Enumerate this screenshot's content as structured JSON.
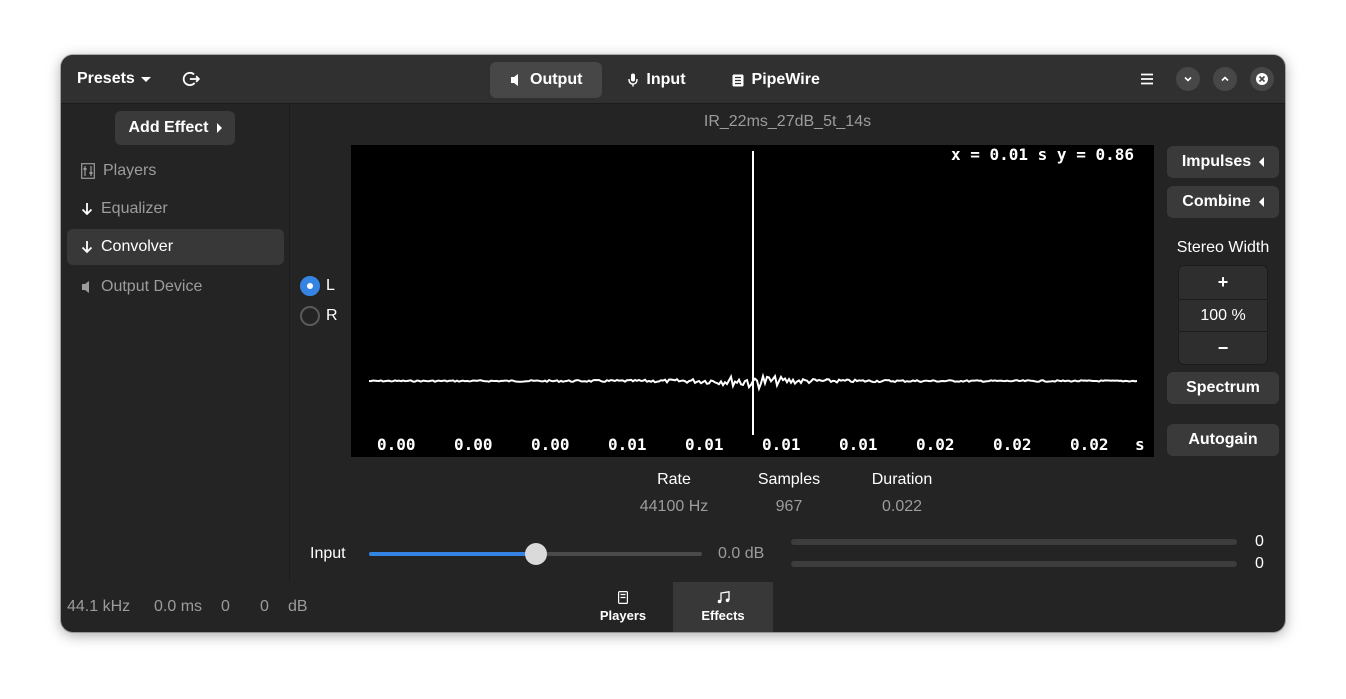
{
  "header": {
    "presets_label": "Presets",
    "tabs": [
      {
        "label": "Output",
        "icon": "speaker-icon",
        "active": true
      },
      {
        "label": "Input",
        "icon": "microphone-icon",
        "active": false
      },
      {
        "label": "PipeWire",
        "icon": "pipewire-icon",
        "active": false
      }
    ]
  },
  "sidebar": {
    "add_effect_label": "Add Effect",
    "items": [
      {
        "label": "Players",
        "icon": "players-icon"
      },
      {
        "label": "Equalizer",
        "icon": "arrow-down-icon"
      },
      {
        "label": "Convolver",
        "icon": "arrow-down-icon",
        "selected": true
      },
      {
        "label": "Output Device",
        "icon": "speaker-icon"
      }
    ]
  },
  "convolver": {
    "impulse_name": "IR_22ms_27dB_5t_14s",
    "coord_readout": "x = 0.01 s y = 0.86",
    "channel_left": "L",
    "channel_right": "R",
    "selected_channel": "L",
    "x_ticks": [
      "0.00",
      "0.00",
      "0.00",
      "0.01",
      "0.01",
      "0.01",
      "0.01",
      "0.02",
      "0.02",
      "0.02",
      "s"
    ],
    "impulses_label": "Impulses",
    "combine_label": "Combine",
    "stereo_width_label": "Stereo Width",
    "stereo_width_value": "100 %",
    "plus_label": "+",
    "minus_label": "−",
    "spectrum_label": "Spectrum",
    "autogain_label": "Autogain",
    "rate_label": "Rate",
    "rate_value": "44100 Hz",
    "samples_label": "Samples",
    "samples_value": "967",
    "duration_label": "Duration",
    "duration_value": "0.022",
    "input_label": "Input",
    "input_gain": "0.0 dB",
    "input_slider_fraction": 0.5,
    "level_left": "0",
    "level_right": "0"
  },
  "status": {
    "sample_rate": "44.1 kHz",
    "latency": "0.0 ms",
    "level_a": "0",
    "level_b": "0",
    "unit": "dB"
  },
  "bottom_tabs": [
    {
      "label": "Players",
      "icon": "players-tab-icon",
      "active": false
    },
    {
      "label": "Effects",
      "icon": "music-note-icon",
      "active": true
    }
  ],
  "colors": {
    "accent": "#3584e4",
    "window_bg": "#242424",
    "header_bg": "#303030",
    "plot_bg": "#000000"
  }
}
